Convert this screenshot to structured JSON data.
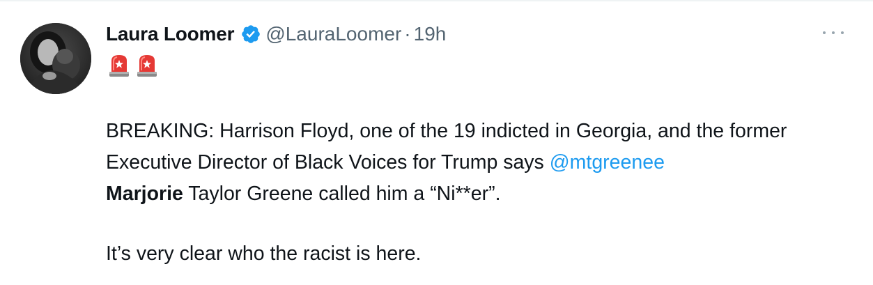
{
  "tweet": {
    "author": {
      "display_name": "Laura Loomer",
      "handle": "@LauraLoomer",
      "verified_icon": "verified-badge-icon"
    },
    "separator": "·",
    "time": "19h",
    "more_icon": "more-options-icon",
    "emoji": [
      "police-siren-icon",
      "police-siren-icon"
    ],
    "body": {
      "part1": "BREAKING: Harrison Floyd, one of the 19 indicted in Georgia, and the former Executive Director of Black Voices for Trump says ",
      "mention": "@mtgreenee",
      "bold_name": "Marjorie",
      "part2": " Taylor Greene called him a “Ni**er”."
    },
    "closing": "It’s very clear who the racist is here."
  },
  "colors": {
    "text": "#0f1419",
    "secondary": "#536471",
    "link": "#1d9bf0",
    "verified": "#1d9bf0",
    "siren_red": "#e53935"
  }
}
